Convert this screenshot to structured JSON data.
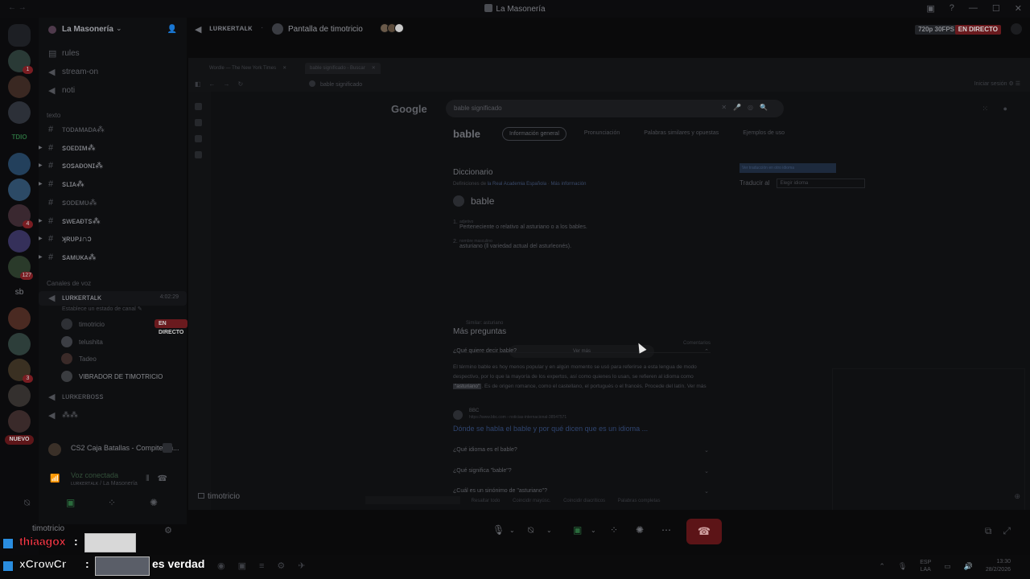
{
  "window": {
    "title": "La Masonería"
  },
  "guild": {
    "name": "La Masonería"
  },
  "servers": {
    "badges": [
      "1",
      "4",
      "3",
      "127",
      "3"
    ],
    "label_todo": "TDIO",
    "label_sb": "sb",
    "nuevo": "NUEVO"
  },
  "channels": {
    "text": [
      {
        "name": "rules"
      },
      {
        "name": "stream-on"
      },
      {
        "name": "noti"
      }
    ],
    "category_texto": "texto",
    "glyph_channels": [
      {
        "name": "ᴛᴏᴅᴀᴍᴀᴅᴀ⁂"
      },
      {
        "name": "ꜱᴏᴇᴅɪᴍ⁂"
      },
      {
        "name": "ꜱᴏꜱᴀᴆᴏɴɪ⁂"
      },
      {
        "name": "ꜱʟɪᴀ⁂"
      },
      {
        "name": "ꜱᴏᴅᴇᴍᴜ⁂"
      },
      {
        "name": "ꜱᴡᴇᴀᴆᴛꜱ⁂"
      },
      {
        "name": "ʞʀᴜᴘɹ∩ɔ"
      },
      {
        "name": "ꜱᴀᴍᴜᴋᴀ⁂"
      }
    ],
    "category_voice": "Canales de voz",
    "voice": {
      "name": "ʟᴜʀᴋᴇʀᴛᴀʟᴋ",
      "time": "4:02:29",
      "subtitle": "Establece un estado de canal ✎",
      "users": [
        {
          "name": "timotricio",
          "live": "EN DIRECTO"
        },
        {
          "name": "telushita"
        },
        {
          "name": "Tadeo"
        },
        {
          "name": "VIBRADOR DE TIMOTRICIO"
        }
      ],
      "others": [
        {
          "name": "ʟᴜʀᴋᴇʀʙᴏꜱꜱ"
        },
        {
          "name": "⁂⁂"
        }
      ]
    }
  },
  "activity": {
    "label": "CS2 Caja Batallas - Compite en..."
  },
  "voice_connected": {
    "status": "Voz conectada",
    "location": "ʟᴜʀᴋᴇʀᴛᴀʟᴋ / La Masonería"
  },
  "user": {
    "name": "timotricio"
  },
  "streambar": {
    "channel": "ʟᴜʀᴋᴇʀᴛᴀʟᴋ",
    "stream_name": "Pantalla de timotricio",
    "quality": "720p 30FPS",
    "live": "EN DIRECTO"
  },
  "stream_label": "timotricio",
  "browser": {
    "tabs": [
      {
        "label": "Wordle — The New York Times"
      },
      {
        "label": "bable significado - Buscar"
      }
    ],
    "address": "bable significado",
    "signin": "Iniciar sesión",
    "google": "Google",
    "query": "bable significado",
    "result_title": "bable",
    "result_tabs": [
      "Información general",
      "Pronunciación",
      "Palabras similares y opuestas",
      "Ejemplos de uso"
    ],
    "dictionary": {
      "heading": "Diccionario",
      "source_prefix": "Definiciones de",
      "source_link": "la Real Academia Española",
      "more": "Más información",
      "word": "bable",
      "defs": [
        {
          "n": "1.",
          "cat": "adjetivo",
          "text": "Perteneciente o relativo al asturiano o a los bables."
        },
        {
          "n": "2.",
          "cat": "nombre masculino",
          "text": "asturiano (‖ variedad actual del asturleonés)."
        }
      ],
      "synonyms": "Similar: asturiano",
      "comments": "Comentarios",
      "see_more": "Ver más"
    },
    "translate": {
      "tag": "Ver traducción en otro idioma",
      "label": "Traducir al",
      "select": "Elegir idioma"
    },
    "more_questions": {
      "heading": "Más preguntas",
      "questions": [
        "¿Qué quiere decir bable?",
        "¿Qué idioma es el bable?",
        "¿Qué significa \"bable\"?",
        "¿Cuál es un sinónimo de \"asturiano\"?"
      ],
      "answer_pre": "El término bable es hoy menos popular y en algún momento se usó para referirse a esta lengua de modo despectivo, por lo que la mayoría de los expertos, así como quienes lo usan, se refieren al idioma como",
      "answer_hl": "\"asturiano\"",
      "answer_post": ". Es de origen romance, como el castellano, el portugués o el francés. Procede del latín.",
      "answer_more": "Ver más",
      "source_name": "BBC",
      "source_url": "https://www.bbc.com › noticias-internacional-38547571",
      "source_link": "Dónde se habla el bable y por qué dicen que es un idioma ..."
    },
    "find_bar": [
      "Resaltar todo",
      "Coincidir mayúsc.",
      "Coincidir diacríticos",
      "Palabras completas"
    ]
  },
  "chat": [
    {
      "nick": "thiaagox",
      "sep": ":",
      "message": "",
      "nick_color": "#ff3b4a"
    },
    {
      "nick": "xCrowCr",
      "sep": ":",
      "message": "es verdad",
      "nick_color": "#ffffff"
    }
  ],
  "taskbar": {
    "lang_top": "ESP",
    "lang_bottom": "LAA",
    "time": "13:30",
    "date": "28/2/2026"
  }
}
